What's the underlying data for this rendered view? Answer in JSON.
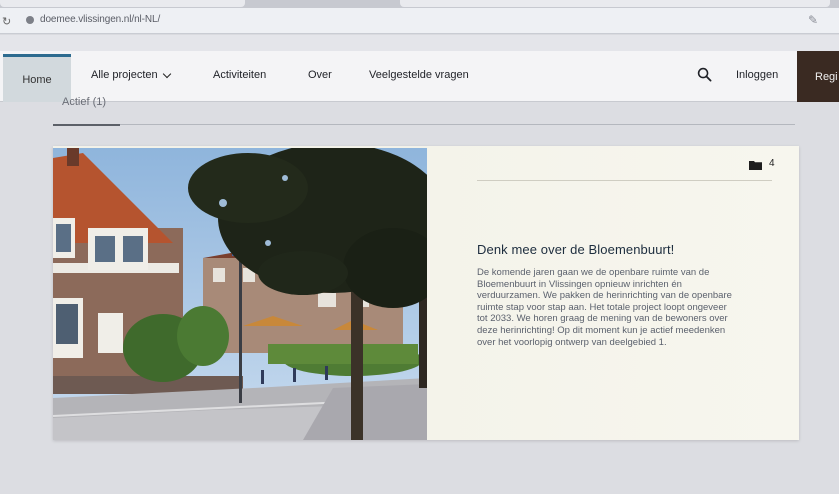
{
  "browser": {
    "url": "doemee.vlissingen.nl/nl-NL/"
  },
  "nav": {
    "home": "Home",
    "projects": "Alle projecten",
    "activities": "Activiteiten",
    "about": "Over",
    "faq": "Veelgestelde vragen",
    "login": "Inloggen",
    "register": "Regi"
  },
  "subtab": {
    "label": "Actief (1)"
  },
  "project": {
    "title": "Denk mee over de Bloemenbuurt!",
    "description": "De komende jaren gaan we de openbare ruimte van de Bloemenbuurt in Vlissingen opnieuw inrichten én verduurzamen. We pakken de herinrichting van de openbare ruimte stap voor stap aan. Het totale project loopt ongeveer tot 2033. We horen graag de mening van de bewoners over deze herinrichting! Op dit moment kun je actief meedenken over het voorlopig ontwerp van deelgebied 1.",
    "folder_count": "4"
  },
  "icons": {
    "search": "search-icon",
    "folder": "folder-icon",
    "chevron": "chevron-down-icon"
  },
  "colors": {
    "home_active_border": "#2d6b8f",
    "register_bg": "#3a2a22",
    "title_color": "#1d2d3e"
  }
}
